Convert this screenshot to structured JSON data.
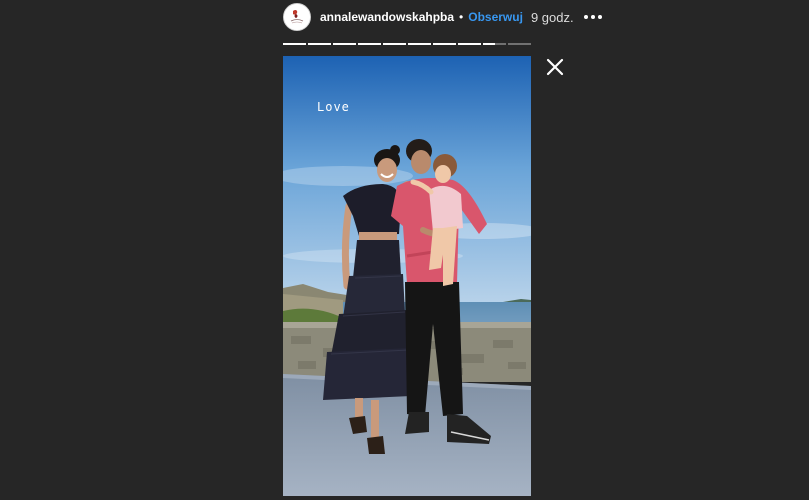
{
  "header": {
    "username": "annalewandowskahpba",
    "separator": "•",
    "follow_label": "Obserwuj",
    "time": "9 godz."
  },
  "icons": {
    "more": "more-options-icon",
    "close": "close-icon"
  },
  "progress": {
    "segments_total": 10,
    "segments_completed": 8,
    "current_segment_fill": 0.5
  },
  "story": {
    "sticker_text": "Love"
  },
  "colors": {
    "background": "#262626",
    "follow": "#3897f0"
  }
}
